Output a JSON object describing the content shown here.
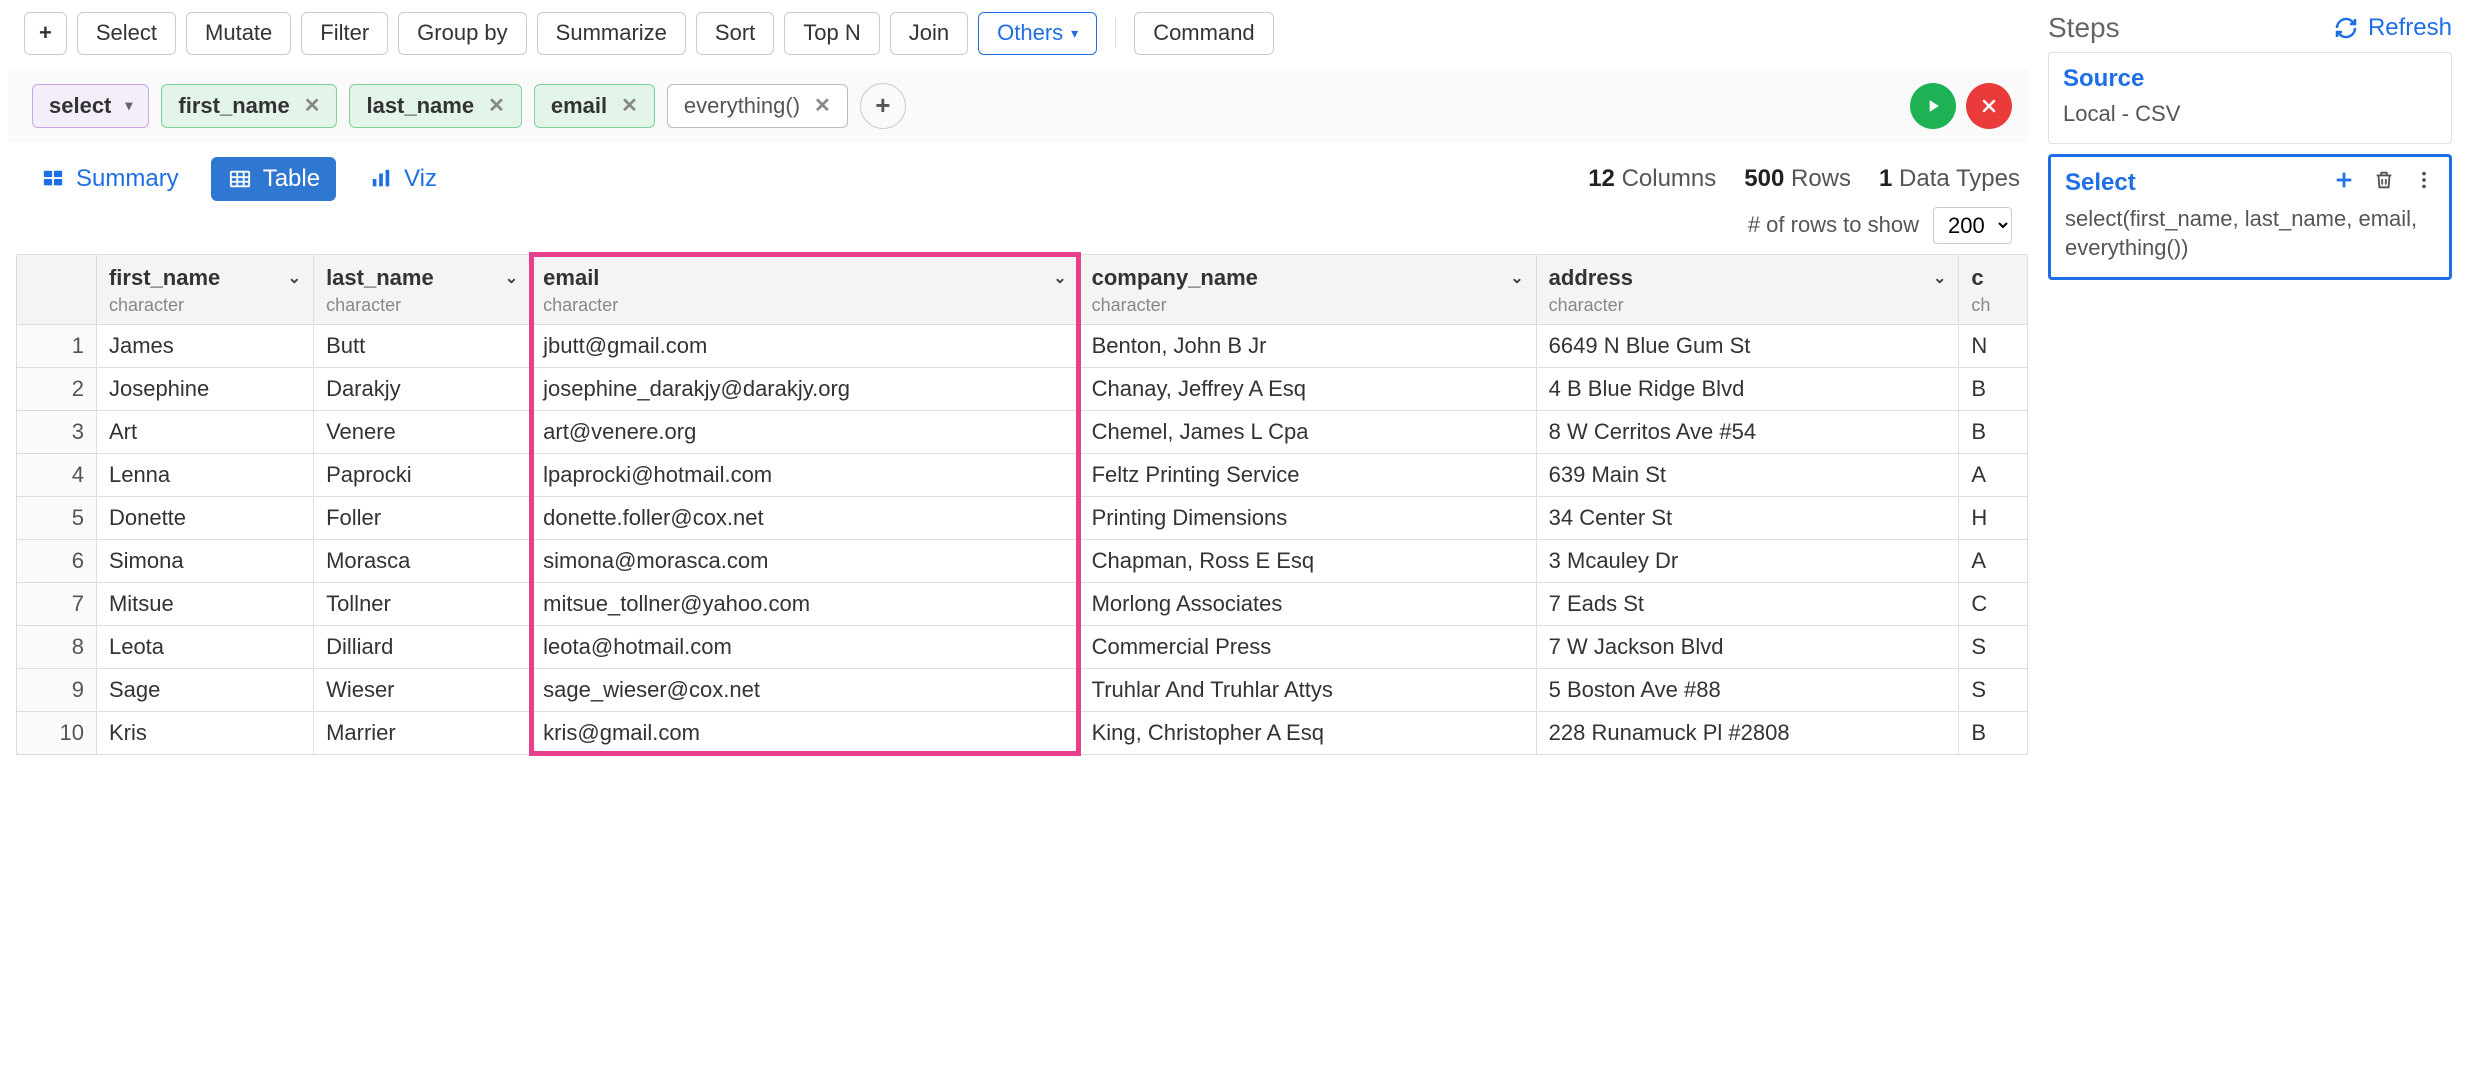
{
  "toolbar": {
    "select": "Select",
    "mutate": "Mutate",
    "filter": "Filter",
    "group_by": "Group by",
    "summarize": "Summarize",
    "sort": "Sort",
    "top_n": "Top N",
    "join": "Join",
    "others": "Others",
    "command": "Command"
  },
  "pills": {
    "verb": "select",
    "cols": [
      "first_name",
      "last_name",
      "email"
    ],
    "func": "everything()"
  },
  "view_tabs": {
    "summary": "Summary",
    "table": "Table",
    "viz": "Viz"
  },
  "stats": {
    "cols_n": "12",
    "cols_l": "Columns",
    "rows_n": "500",
    "rows_l": "Rows",
    "types_n": "1",
    "types_l": "Data Types"
  },
  "rows_to_show": {
    "label": "# of rows to show",
    "value": "200"
  },
  "columns": [
    {
      "name": "first_name",
      "type": "character"
    },
    {
      "name": "last_name",
      "type": "character"
    },
    {
      "name": "email",
      "type": "character"
    },
    {
      "name": "company_name",
      "type": "character"
    },
    {
      "name": "address",
      "type": "character"
    },
    {
      "name": "c",
      "type": "ch"
    }
  ],
  "rows": [
    {
      "n": "1",
      "first": "James",
      "last": "Butt",
      "email": "jbutt@gmail.com",
      "company": "Benton, John B Jr",
      "address": "6649 N Blue Gum St",
      "c": "N"
    },
    {
      "n": "2",
      "first": "Josephine",
      "last": "Darakjy",
      "email": "josephine_darakjy@darakjy.org",
      "company": "Chanay, Jeffrey A Esq",
      "address": "4 B Blue Ridge Blvd",
      "c": "B"
    },
    {
      "n": "3",
      "first": "Art",
      "last": "Venere",
      "email": "art@venere.org",
      "company": "Chemel, James L Cpa",
      "address": "8 W Cerritos Ave #54",
      "c": "B"
    },
    {
      "n": "4",
      "first": "Lenna",
      "last": "Paprocki",
      "email": "lpaprocki@hotmail.com",
      "company": "Feltz Printing Service",
      "address": "639 Main St",
      "c": "A"
    },
    {
      "n": "5",
      "first": "Donette",
      "last": "Foller",
      "email": "donette.foller@cox.net",
      "company": "Printing Dimensions",
      "address": "34 Center St",
      "c": "H"
    },
    {
      "n": "6",
      "first": "Simona",
      "last": "Morasca",
      "email": "simona@morasca.com",
      "company": "Chapman, Ross E Esq",
      "address": "3 Mcauley Dr",
      "c": "A"
    },
    {
      "n": "7",
      "first": "Mitsue",
      "last": "Tollner",
      "email": "mitsue_tollner@yahoo.com",
      "company": "Morlong Associates",
      "address": "7 Eads St",
      "c": "C"
    },
    {
      "n": "8",
      "first": "Leota",
      "last": "Dilliard",
      "email": "leota@hotmail.com",
      "company": "Commercial Press",
      "address": "7 W Jackson Blvd",
      "c": "S"
    },
    {
      "n": "9",
      "first": "Sage",
      "last": "Wieser",
      "email": "sage_wieser@cox.net",
      "company": "Truhlar And Truhlar Attys",
      "address": "5 Boston Ave #88",
      "c": "S"
    },
    {
      "n": "10",
      "first": "Kris",
      "last": "Marrier",
      "email": "kris@gmail.com",
      "company": "King, Christopher A Esq",
      "address": "228 Runamuck Pl #2808",
      "c": "B"
    }
  ],
  "side": {
    "title": "Steps",
    "refresh": "Refresh",
    "source": {
      "title": "Source",
      "sub": "Local - CSV"
    },
    "select": {
      "title": "Select",
      "sub": "select(first_name, last_name, email, everything())"
    }
  }
}
